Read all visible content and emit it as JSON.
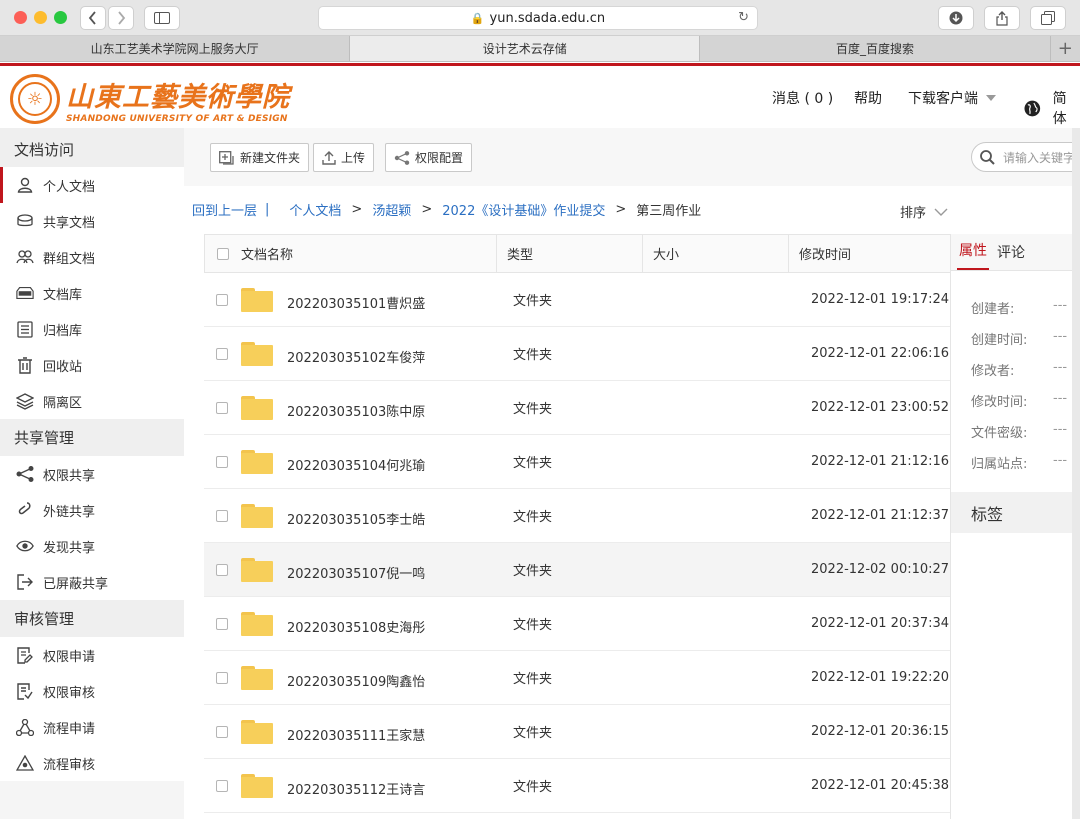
{
  "browser": {
    "url": "yun.sdada.edu.cn",
    "tabs": [
      {
        "label": "山东工艺美术学院网上服务大厅"
      },
      {
        "label": "设计艺术云存储"
      },
      {
        "label": "百度_百度搜索"
      }
    ],
    "new_tab": "+"
  },
  "site": {
    "logo_cn": "山東工藝美術學院",
    "logo_en": "SHANDONG UNIVERSITY OF ART & DESIGN",
    "nav": {
      "messages": "消息 ( 0 )",
      "help": "帮助",
      "download": "下载客户端",
      "language": "简体"
    }
  },
  "sidebar": {
    "sections": [
      {
        "title": "文档访问",
        "items": [
          {
            "label": "个人文档",
            "icon": "person-icon"
          },
          {
            "label": "共享文档",
            "icon": "shared-docs-icon"
          },
          {
            "label": "群组文档",
            "icon": "group-icon"
          },
          {
            "label": "文档库",
            "icon": "library-icon"
          },
          {
            "label": "归档库",
            "icon": "archive-icon"
          },
          {
            "label": "回收站",
            "icon": "trash-icon"
          },
          {
            "label": "隔离区",
            "icon": "quarantine-icon"
          }
        ]
      },
      {
        "title": "共享管理",
        "items": [
          {
            "label": "权限共享",
            "icon": "share-icon"
          },
          {
            "label": "外链共享",
            "icon": "link-icon"
          },
          {
            "label": "发现共享",
            "icon": "eye-icon"
          },
          {
            "label": "已屏蔽共享",
            "icon": "exit-icon"
          }
        ]
      },
      {
        "title": "审核管理",
        "items": [
          {
            "label": "权限申请",
            "icon": "doc-edit-icon"
          },
          {
            "label": "权限审核",
            "icon": "doc-check-icon"
          },
          {
            "label": "流程申请",
            "icon": "flow-icon"
          },
          {
            "label": "流程审核",
            "icon": "flow-review-icon"
          }
        ]
      }
    ]
  },
  "toolbar": {
    "new_folder": "新建文件夹",
    "upload": "上传",
    "permissions": "权限配置",
    "search_placeholder": "请输入关键字"
  },
  "breadcrumb": {
    "back": "回到上一层",
    "divider": "|",
    "separator": ">",
    "items": [
      "个人文档",
      "汤超颖",
      "2022《设计基础》作业提交"
    ],
    "current": "第三周作业"
  },
  "sort_label": "排序",
  "table": {
    "columns": [
      "文档名称",
      "类型",
      "大小",
      "修改时间"
    ],
    "rows": [
      {
        "name": "202203035101曹炽盛",
        "type": "文件夹",
        "size": "",
        "modified": "2022-12-01 19:17:24"
      },
      {
        "name": "202203035102车俊萍",
        "type": "文件夹",
        "size": "",
        "modified": "2022-12-01 22:06:16"
      },
      {
        "name": "202203035103陈中原",
        "type": "文件夹",
        "size": "",
        "modified": "2022-12-01 23:00:52"
      },
      {
        "name": "202203035104何兆瑜",
        "type": "文件夹",
        "size": "",
        "modified": "2022-12-01 21:12:16"
      },
      {
        "name": "202203035105李士皓",
        "type": "文件夹",
        "size": "",
        "modified": "2022-12-01 21:12:37"
      },
      {
        "name": "202203035107倪一鸣",
        "type": "文件夹",
        "size": "",
        "modified": "2022-12-02 00:10:27"
      },
      {
        "name": "202203035108史海彤",
        "type": "文件夹",
        "size": "",
        "modified": "2022-12-01 20:37:34"
      },
      {
        "name": "202203035109陶鑫怡",
        "type": "文件夹",
        "size": "",
        "modified": "2022-12-01 19:22:20"
      },
      {
        "name": "202203035111王家慧",
        "type": "文件夹",
        "size": "",
        "modified": "2022-12-01 20:36:15"
      },
      {
        "name": "202203035112王诗言",
        "type": "文件夹",
        "size": "",
        "modified": "2022-12-01 20:45:38"
      }
    ]
  },
  "properties": {
    "tabs": [
      "属性",
      "评论"
    ],
    "fields": [
      {
        "label": "创建者:",
        "value": "---"
      },
      {
        "label": "创建时间:",
        "value": "---"
      },
      {
        "label": "修改者:",
        "value": "---"
      },
      {
        "label": "修改时间:",
        "value": "---"
      },
      {
        "label": "文件密级:",
        "value": "---"
      },
      {
        "label": "归属站点:",
        "value": "---"
      }
    ],
    "tags_title": "标签"
  },
  "colors": {
    "brand_red": "#c0161d",
    "logo_orange": "#e8731b",
    "link_blue": "#2b6fc2",
    "folder_yellow": "#f7cf5a"
  }
}
